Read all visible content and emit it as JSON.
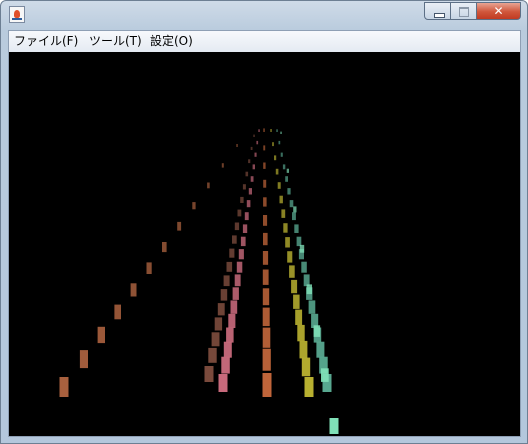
{
  "window": {
    "icon": "java-cup-icon",
    "controls": {
      "minimize_icon": "minimize-icon",
      "maximize_icon": "maximize-icon",
      "close_icon": "close-icon",
      "close_glyph": "✕"
    }
  },
  "menubar": {
    "items": [
      {
        "label": "ファイル(F)"
      },
      {
        "label": "ツール(T)"
      },
      {
        "label": "設定(O)"
      }
    ]
  },
  "scene": {
    "background": "#000000",
    "track_colors": [
      "#a8603e",
      "#7a4a3c",
      "#c86a7c",
      "#c0653a",
      "#b8b030",
      "#58a890",
      "#80e0b8"
    ]
  }
}
